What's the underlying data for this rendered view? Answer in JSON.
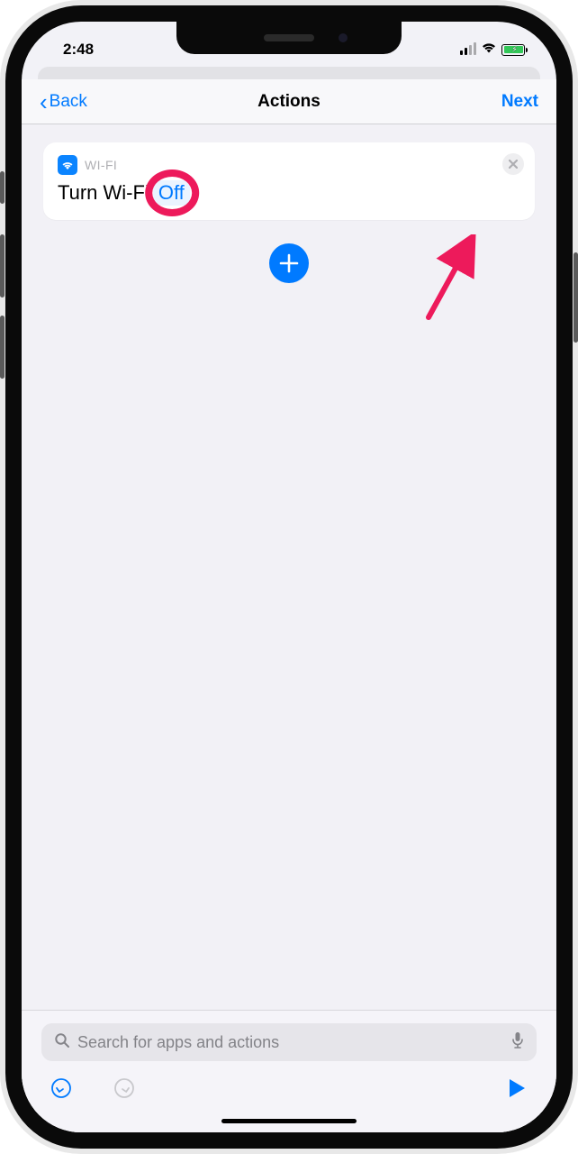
{
  "status_bar": {
    "time": "2:48"
  },
  "nav": {
    "back_label": "Back",
    "title": "Actions",
    "next_label": "Next"
  },
  "action_card": {
    "category": "WI-FI",
    "action_prefix": "Turn Wi-Fi",
    "action_param": "Off"
  },
  "search": {
    "placeholder": "Search for apps and actions"
  }
}
